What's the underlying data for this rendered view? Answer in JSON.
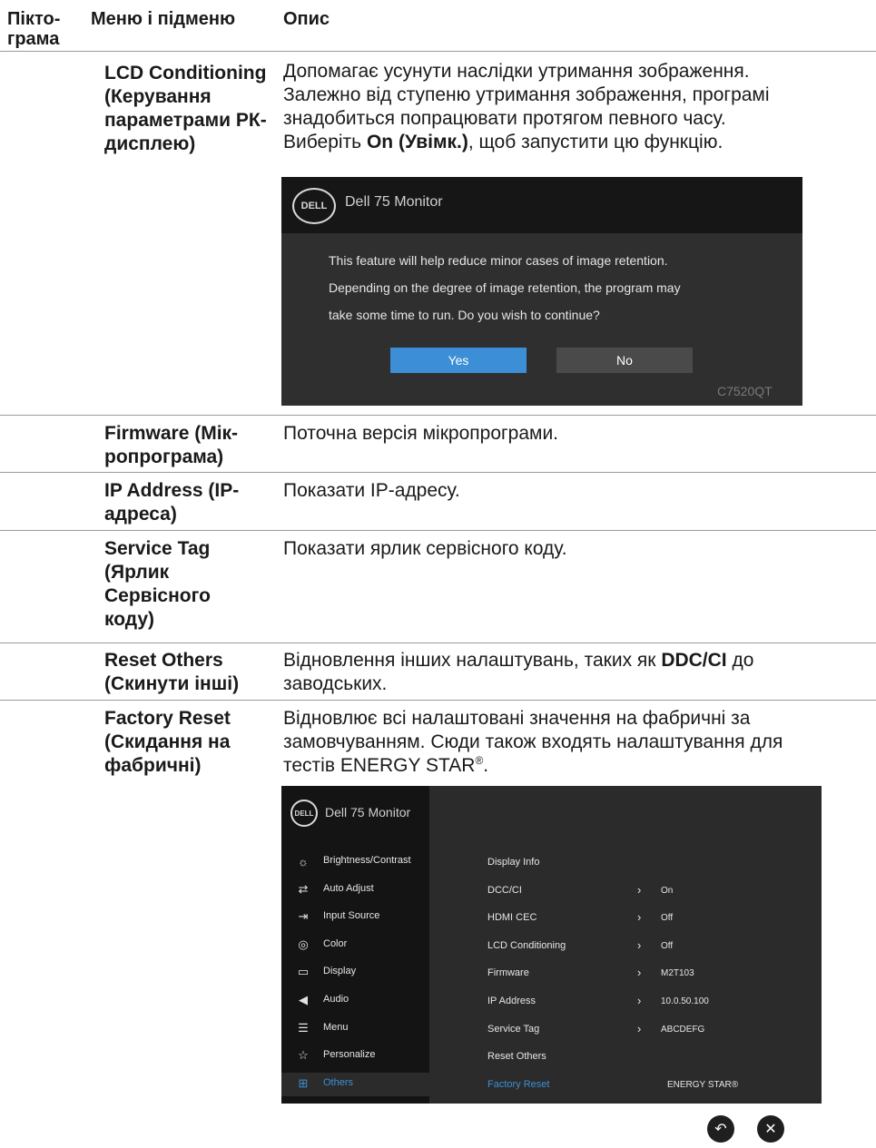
{
  "header": {
    "col_icon": "Пікто-\nграма",
    "col_menu": "Меню і підменю",
    "col_desc": "Опис"
  },
  "rows": {
    "lcd": {
      "menu": "LCD Conditioning (Керування параметрами РК-дисплею)",
      "desc_line1": "Допомагає усунути наслідки утримання зображення.",
      "desc_line2": "Залежно від ступеню утримання зображення, програмі",
      "desc_line3": "знадобиться попрацювати протягом певного часу.",
      "desc_pre": "Виберіть ",
      "desc_bold": "On (Увімк.)",
      "desc_post": ", щоб запустити цю функцію."
    },
    "firmware": {
      "menu": "Firmware (Мік-ропрограма)",
      "desc": "Поточна версія мікропрограми."
    },
    "ip": {
      "menu": "IP Address (IP-адреса)",
      "desc": "Показати IP-адресу."
    },
    "service": {
      "menu": "Service Tag (Ярлик Сервісного коду)",
      "desc": "Показати ярлик сервісного коду."
    },
    "reset_others": {
      "menu": "Reset Others (Скинути інші)",
      "desc_pre": "Відновлення інших налаштувань, таких як ",
      "desc_bold": "DDC/CI",
      "desc_post": " до заводських."
    },
    "factory": {
      "menu": "Factory Reset (Скидання на фабричні)",
      "desc_line1": "Відновлює всі налаштовані значення на фабричні за",
      "desc_line2": "замовчуванням. Сюди також входять налаштування для",
      "desc_line3_pre": "тестів ENERGY STAR",
      "desc_line3_sup": "®",
      "desc_line3_post": "."
    }
  },
  "dialog": {
    "logo": "DELL",
    "title": "Dell 75 Monitor",
    "line1": "This feature will help reduce minor cases of image retention.",
    "line2": "Depending on the degree of image retention, the program may",
    "line3": "take some time to run. Do you wish to continue?",
    "yes": "Yes",
    "no": "No",
    "model": "C7520QT",
    "colors": {
      "yes_bg": "#3c8fd6",
      "no_bg": "#4a4a4a"
    }
  },
  "osd": {
    "logo": "DELL",
    "title": "Dell 75 Monitor",
    "menu": [
      {
        "icon": "brightness-icon",
        "glyph": "☼",
        "label": "Brightness/Contrast"
      },
      {
        "icon": "auto-adjust-icon",
        "glyph": "⇄",
        "label": "Auto Adjust"
      },
      {
        "icon": "input-source-icon",
        "glyph": "⇥",
        "label": "Input Source"
      },
      {
        "icon": "color-icon",
        "glyph": "◎",
        "label": "Color"
      },
      {
        "icon": "display-icon",
        "glyph": "▭",
        "label": "Display"
      },
      {
        "icon": "audio-icon",
        "glyph": "◀",
        "label": "Audio"
      },
      {
        "icon": "menu-icon",
        "glyph": "☰",
        "label": "Menu"
      },
      {
        "icon": "personalize-icon",
        "glyph": "☆",
        "label": "Personalize"
      },
      {
        "icon": "others-icon",
        "glyph": "⊞",
        "label": "Others",
        "selected": true
      }
    ],
    "submenu": [
      {
        "label": "Display Info",
        "chevron": "",
        "value": ""
      },
      {
        "label": "DCC/CI",
        "chevron": "›",
        "value": "On"
      },
      {
        "label": "HDMI CEC",
        "chevron": "›",
        "value": "Off"
      },
      {
        "label": "LCD Conditioning",
        "chevron": "›",
        "value": "Off"
      },
      {
        "label": "Firmware",
        "chevron": "›",
        "value": "M2T103"
      },
      {
        "label": "IP Address",
        "chevron": "›",
        "value": "10.0.50.100"
      },
      {
        "label": "Service Tag",
        "chevron": "›",
        "value": "ABCDEFG"
      },
      {
        "label": "Reset Others",
        "chevron": "",
        "value": ""
      },
      {
        "label": "Factory Reset",
        "chevron": "",
        "value": "ENERGY STAR®",
        "selected": true
      }
    ],
    "back_glyph": "↶",
    "close_glyph": "✕",
    "colors": {
      "selected": "#3c8fd6"
    }
  }
}
